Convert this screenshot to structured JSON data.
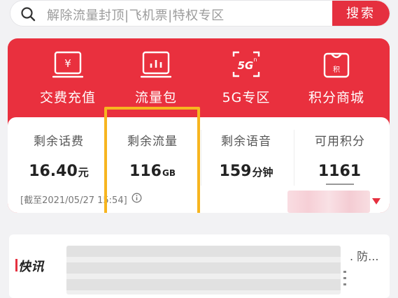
{
  "search": {
    "placeholder": "解除流量封顶|飞机票|特权专区",
    "button_label": "搜索"
  },
  "features": [
    {
      "label": "交费充值",
      "icon": "yuan-wallet-icon"
    },
    {
      "label": "流量包",
      "icon": "bar-chart-icon"
    },
    {
      "label": "5G专区",
      "icon": "5g-icon"
    },
    {
      "label": "积分商城",
      "icon": "shopping-bag-icon"
    }
  ],
  "stats": [
    {
      "label": "剩余话费",
      "value": "16.40",
      "unit": "元"
    },
    {
      "label": "剩余流量",
      "value": "116",
      "unit": "GB"
    },
    {
      "label": "剩余语音",
      "value": "159",
      "unit": "分钟"
    },
    {
      "label": "可用积分",
      "value": "1161",
      "unit": ""
    }
  ],
  "as_of": "[截至2021/05/27 15:54]",
  "news": {
    "tag": "快讯",
    "visible_text": ". 防..."
  },
  "colors": {
    "brand_red": "#e9303e",
    "highlight": "#f7b51f"
  }
}
